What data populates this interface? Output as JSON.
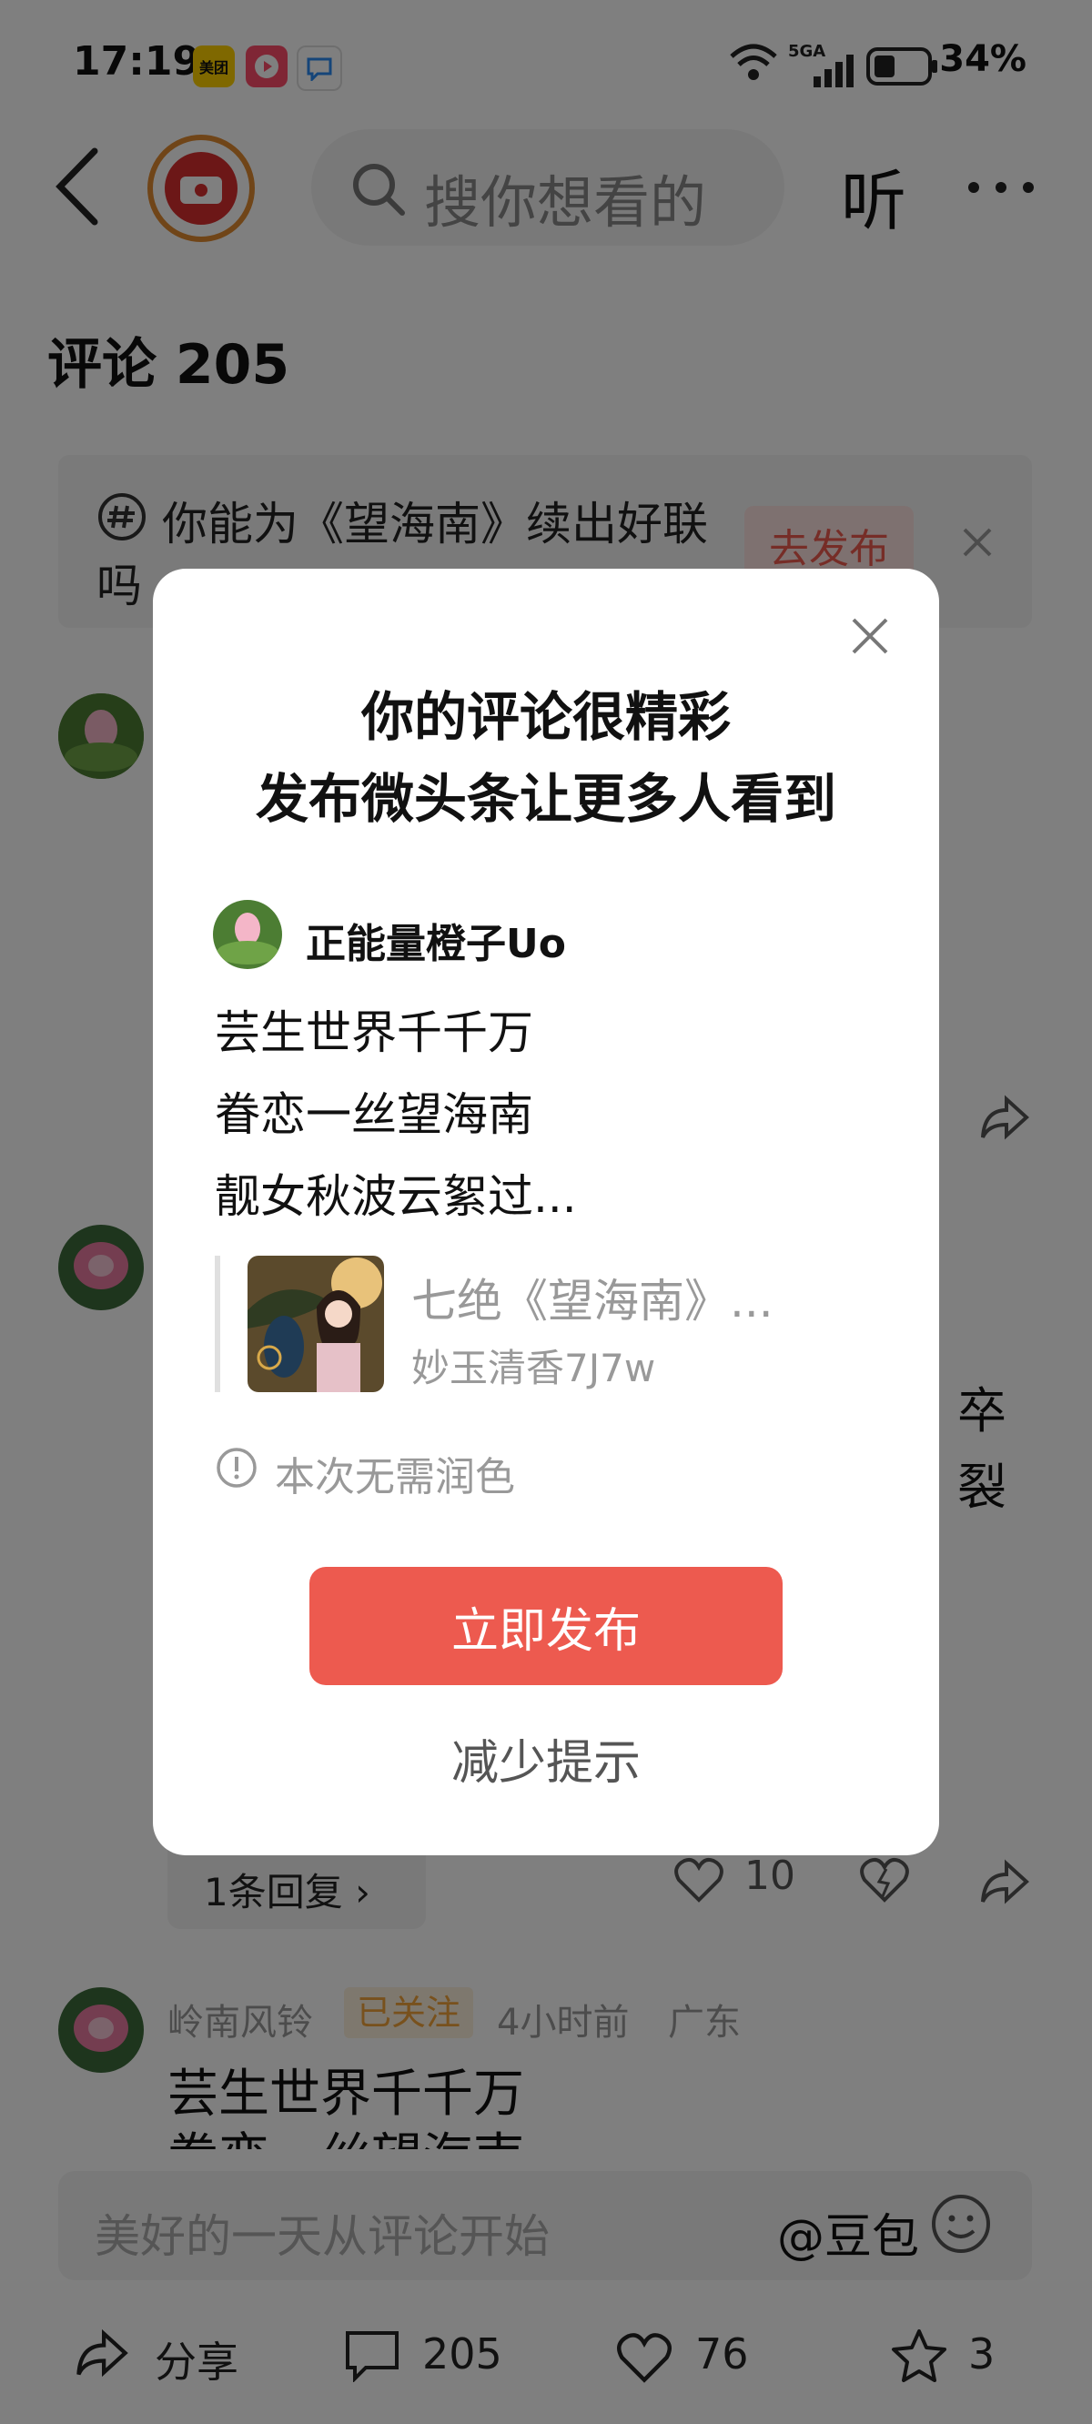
{
  "status": {
    "time": "17:19",
    "apps": [
      "美团",
      "video-app-icon",
      "chat-app-icon"
    ],
    "signal": "5GA",
    "battery": "34%"
  },
  "topbar": {
    "search_placeholder": "搜你想看的",
    "listen": "听"
  },
  "page": {
    "title": "评论 205"
  },
  "banner": {
    "text_line1": "你能为《望海南》续出好联",
    "text_line2": "吗",
    "button": "去发布"
  },
  "comments": [
    {
      "counts_reply": "1条回复",
      "likes": "10"
    },
    {
      "name": "岭南风铃",
      "badge": "已关注",
      "time": "4小时前",
      "region": "广东",
      "text": "芸生世界千千万",
      "text_line2": "眷恋一丝望海南"
    }
  ],
  "input": {
    "placeholder": "美好的一天从评论开始",
    "mention": "@豆包"
  },
  "bottom": {
    "share": "分享",
    "comments": "205",
    "likes": "76",
    "stars": "3"
  },
  "modal": {
    "title_line1": "你的评论很精彩",
    "title_line2": "发布微头条让更多人看到",
    "author": "正能量橙子Uo",
    "lines": [
      "芸生世界千千万",
      "眷恋一丝望海南",
      "靓女秋波云絮过..."
    ],
    "quote_title": "七绝《望海南》...",
    "quote_author": "妙玉清香7J7w",
    "hint": "本次无需润色",
    "publish": "立即发布",
    "reduce": "减少提示"
  },
  "colors": {
    "accent": "#ed5a4f",
    "follow_badge": "#f0a23a"
  }
}
